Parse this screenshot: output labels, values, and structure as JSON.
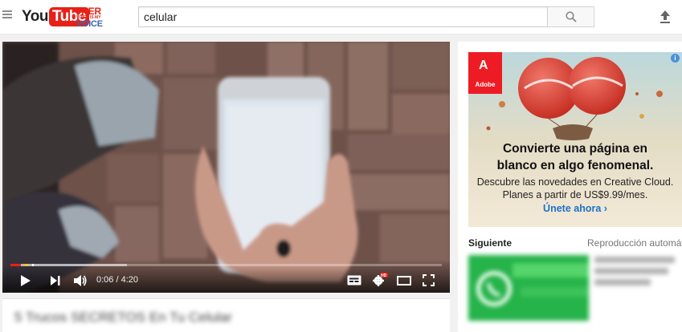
{
  "header": {
    "logo_you": "You",
    "logo_tube": "Tube",
    "campaign_line1": "#HER",
    "campaign_line2": "VOICE IS MY",
    "campaign_line3": "VOICE",
    "search_value": "celular"
  },
  "player": {
    "time_display": "0:06 / 4:20",
    "progress_played": 0.024,
    "progress_loaded": 0.27,
    "hd_badge": "HD"
  },
  "video_title_blurred": "5 Trucos SECRETOS En Tu Celular",
  "ad": {
    "brand": "Adobe",
    "headline_line1": "Convierte una página en",
    "headline_line2": "blanco en algo fenomenal.",
    "sub_line1": "Descubre las novedades en Creative Cloud.",
    "sub_line2": "Planes a partir de US$9.99/mes.",
    "cta": "Únete ahora ›",
    "info_icon": "i"
  },
  "up_next": {
    "label": "Siguiente",
    "autoplay_label": "Reproducción automática"
  },
  "colors": {
    "brand_red": "#e62117",
    "link_blue": "#1a73c8",
    "whatsapp_green": "#1db954"
  }
}
